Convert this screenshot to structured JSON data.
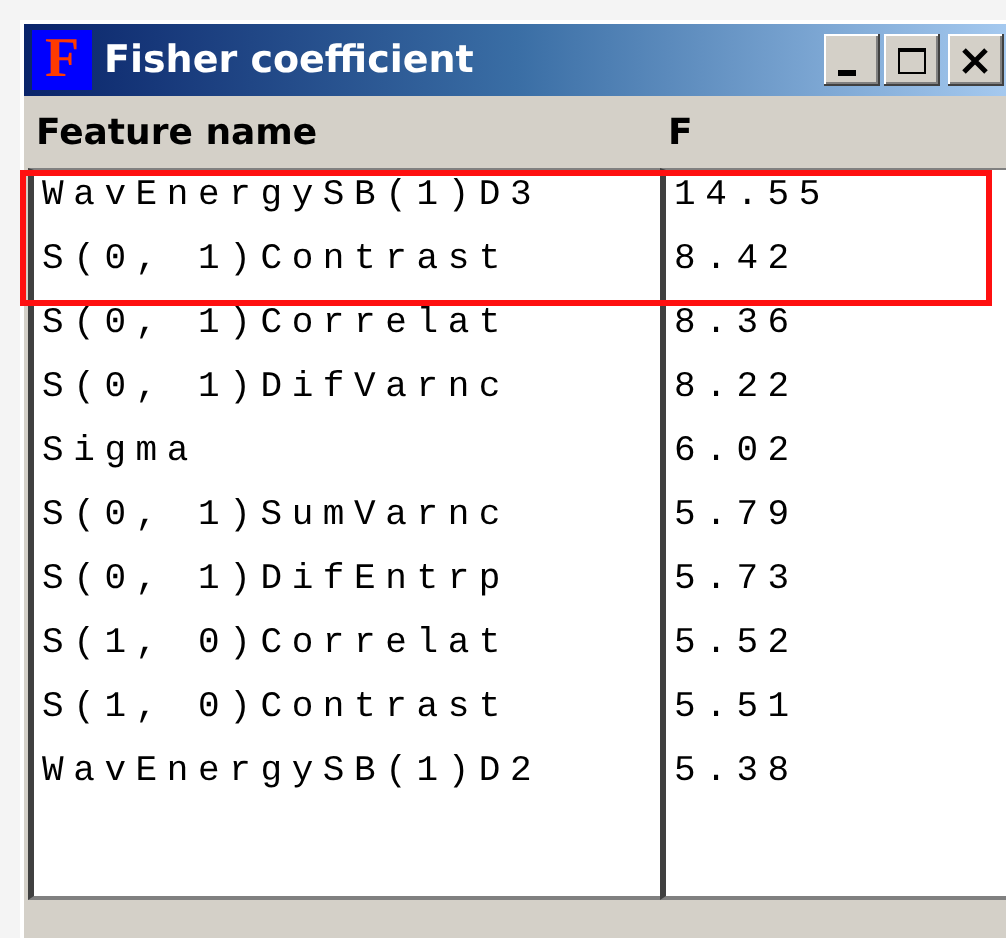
{
  "window": {
    "title": "Fisher coefficient",
    "icon_letter": "F",
    "buttons": [
      {
        "kind": "minimize"
      },
      {
        "kind": "maximize"
      },
      {
        "kind": "close"
      }
    ]
  },
  "columns": [
    "Feature name",
    "F"
  ],
  "rows": [
    {
      "name": "WavEnergySB(1)D3",
      "value": "14.55",
      "highlighted": true
    },
    {
      "name": "S(0, 1)Contrast",
      "value": "8.42",
      "highlighted": true
    },
    {
      "name": "S(0, 1)Correlat",
      "value": "8.36",
      "highlighted": false
    },
    {
      "name": "S(0, 1)DifVarnc",
      "value": "8.22",
      "highlighted": false
    },
    {
      "name": "Sigma",
      "value": "6.02",
      "highlighted": false
    },
    {
      "name": "S(0, 1)SumVarnc",
      "value": "5.79",
      "highlighted": false
    },
    {
      "name": "S(0, 1)DifEntrp",
      "value": "5.73",
      "highlighted": false
    },
    {
      "name": "S(1, 0)Correlat",
      "value": "5.52",
      "highlighted": false
    },
    {
      "name": "S(1, 0)Contrast",
      "value": "5.51",
      "highlighted": false
    },
    {
      "name": "WavEnergySB(1)D2",
      "value": "5.38",
      "highlighted": false
    }
  ]
}
